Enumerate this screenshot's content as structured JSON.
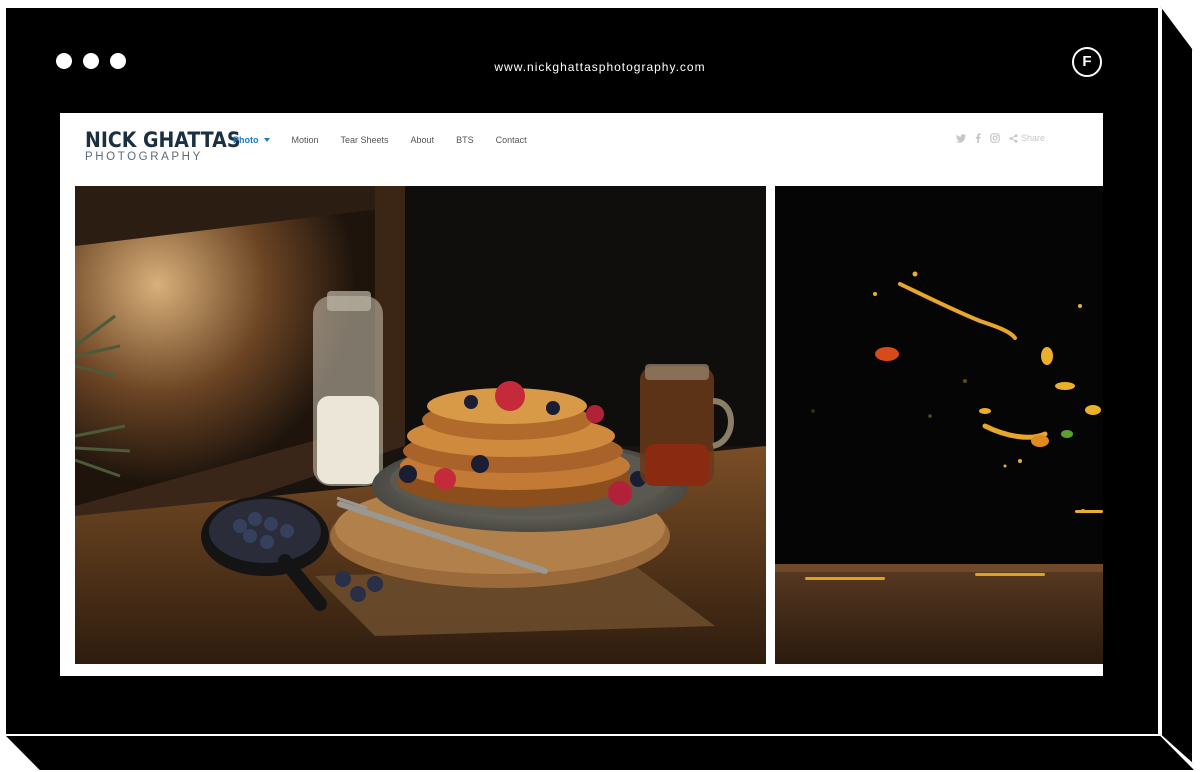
{
  "browser": {
    "url": "www.nickghattasphotography.com",
    "badge_letter": "F"
  },
  "site": {
    "logo_main": "NICK GHATTAS",
    "logo_sub": "PHOTOGRAPHY",
    "nav": [
      {
        "label": "Photo",
        "active": true
      },
      {
        "label": "Motion"
      },
      {
        "label": "Tear Sheets"
      },
      {
        "label": "About"
      },
      {
        "label": "BTS"
      },
      {
        "label": "Contact"
      }
    ],
    "share_label": "Share"
  },
  "colors": {
    "accent": "#1d7bc0",
    "logo": "#1a3040",
    "frame": "#000000"
  },
  "icons": [
    "twitter-icon",
    "facebook-icon",
    "instagram-icon",
    "share-icon"
  ]
}
